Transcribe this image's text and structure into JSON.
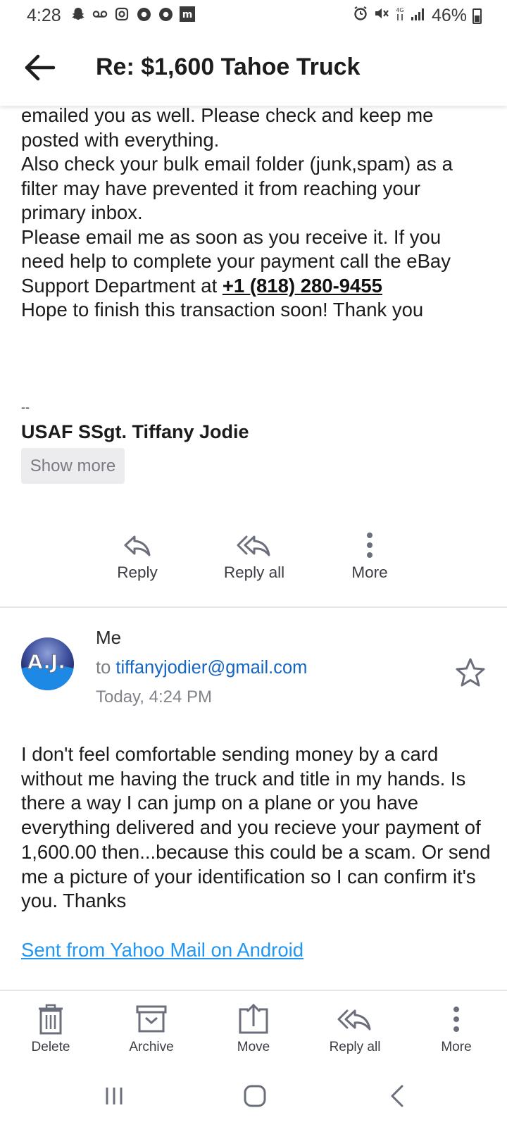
{
  "status_bar": {
    "time": "4:28",
    "battery_percent": "46%",
    "battery_level": 0.46,
    "left_icons": [
      "snapchat-icon",
      "voicemail-icon",
      "instagram-icon",
      "chrome-icon",
      "chrome-icon",
      "app-m-icon"
    ],
    "right_icons": [
      "alarm-icon",
      "mute-icon",
      "data-icon",
      "signal-icon"
    ]
  },
  "header": {
    "back_icon": "arrow-left-icon",
    "subject": "Re: $1,600 Tahoe Truck"
  },
  "message": {
    "paragraphs": [
      "emailed you as well. Please check and keep me posted with everything.",
      "Also check your bulk email folder (junk,spam) as a filter may have prevented it from reaching your primary inbox."
    ],
    "para3_text": "Please email me as soon as you receive it. If you need help to complete your payment call the eBay Support Department at ",
    "phone": "+1 (818) 280-9455",
    "closing": "Hope to finish this transaction soon! Thank you",
    "signature_dashes": "--",
    "signature_name": "USAF SSgt. Tiffany Jodie",
    "show_more_label": "Show more"
  },
  "message_actions": {
    "reply": "Reply",
    "reply_all": "Reply all",
    "more": "More"
  },
  "reply": {
    "sender": "Me",
    "to_label": "to",
    "to_email": "tiffanyjodier@gmail.com",
    "time": "Today, 4:24 PM",
    "body": "I don't feel comfortable sending money by a card without me having the truck and title in my hands. Is there a way I can jump on a plane or you have everything delivered and you recieve your payment of 1,600.00 then...because this could be a scam. Or send me a picture of your identification so I can confirm it's you. Thanks",
    "signature_link": "Sent from Yahoo Mail on Android"
  },
  "toolbar": {
    "delete": "Delete",
    "archive": "Archive",
    "move": "Move",
    "reply_all": "Reply all",
    "more": "More"
  },
  "nav": {
    "buttons": [
      "recent-apps-icon",
      "home-icon",
      "back-icon"
    ]
  },
  "colors": {
    "accent_link": "#1565c0",
    "yahoo_link": "#2196f3",
    "icon_gray": "#6b6f7b"
  }
}
